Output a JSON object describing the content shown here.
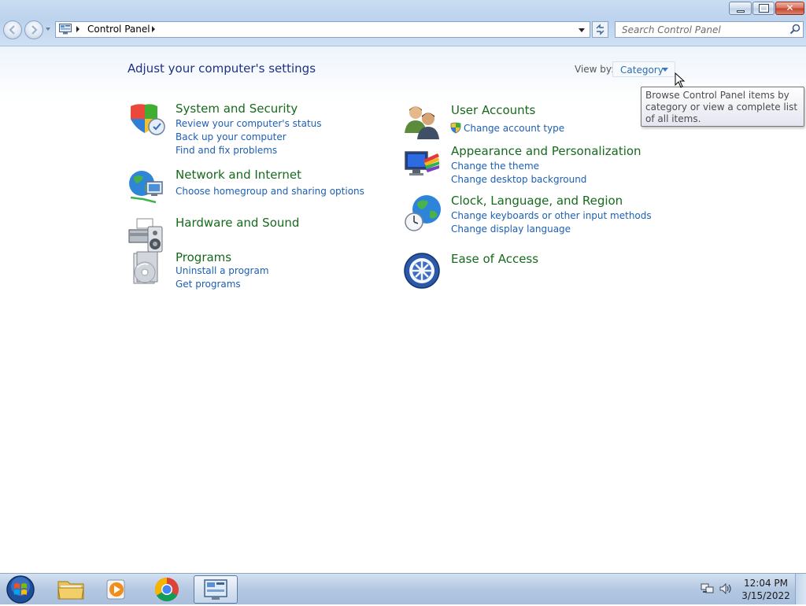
{
  "window": {
    "buttons": {
      "minimize": "minimize",
      "maximize": "restore",
      "close": "✕"
    }
  },
  "address_bar": {
    "breadcrumb": [
      "Control Panel"
    ],
    "icon": "control-panel-icon"
  },
  "search": {
    "placeholder": "Search Control Panel",
    "value": ""
  },
  "header": {
    "title": "Adjust your computer's settings",
    "view_by_label": "View by:",
    "view_by_value": "Category"
  },
  "tooltip": "Browse Control Panel items by category or view a complete list of all items.",
  "categories_left": [
    {
      "title": "System and Security",
      "icon": "shield-icon",
      "links": [
        "Review your computer's status",
        "Back up your computer",
        "Find and fix problems"
      ]
    },
    {
      "title": "Network and Internet",
      "icon": "network-globe-icon",
      "links": [
        "Choose homegroup and sharing options"
      ]
    },
    {
      "title": "Hardware and Sound",
      "icon": "printer-speaker-icon",
      "links": []
    },
    {
      "title": "Programs",
      "icon": "programs-disc-icon",
      "links": [
        "Uninstall a program",
        "Get programs"
      ]
    }
  ],
  "categories_right": [
    {
      "title": "User Accounts",
      "icon": "users-icon",
      "links": [
        "Change account type"
      ]
    },
    {
      "title": "Appearance and Personalization",
      "icon": "monitor-colors-icon",
      "links": [
        "Change the theme",
        "Change desktop background"
      ]
    },
    {
      "title": "Clock, Language, and Region",
      "icon": "globe-clock-icon",
      "links": [
        "Change keyboards or other input methods",
        "Change display language"
      ]
    },
    {
      "title": "Ease of Access",
      "icon": "ease-of-access-icon",
      "links": []
    }
  ],
  "taskbar": {
    "items": [
      "windows-explorer-icon",
      "media-player-icon",
      "chrome-icon",
      "control-panel-icon"
    ],
    "time": "12:04 PM",
    "date": "3/15/2022"
  },
  "colors": {
    "category_title": "#166a1c",
    "link": "#1d5fb3",
    "heading": "#1e3287"
  }
}
